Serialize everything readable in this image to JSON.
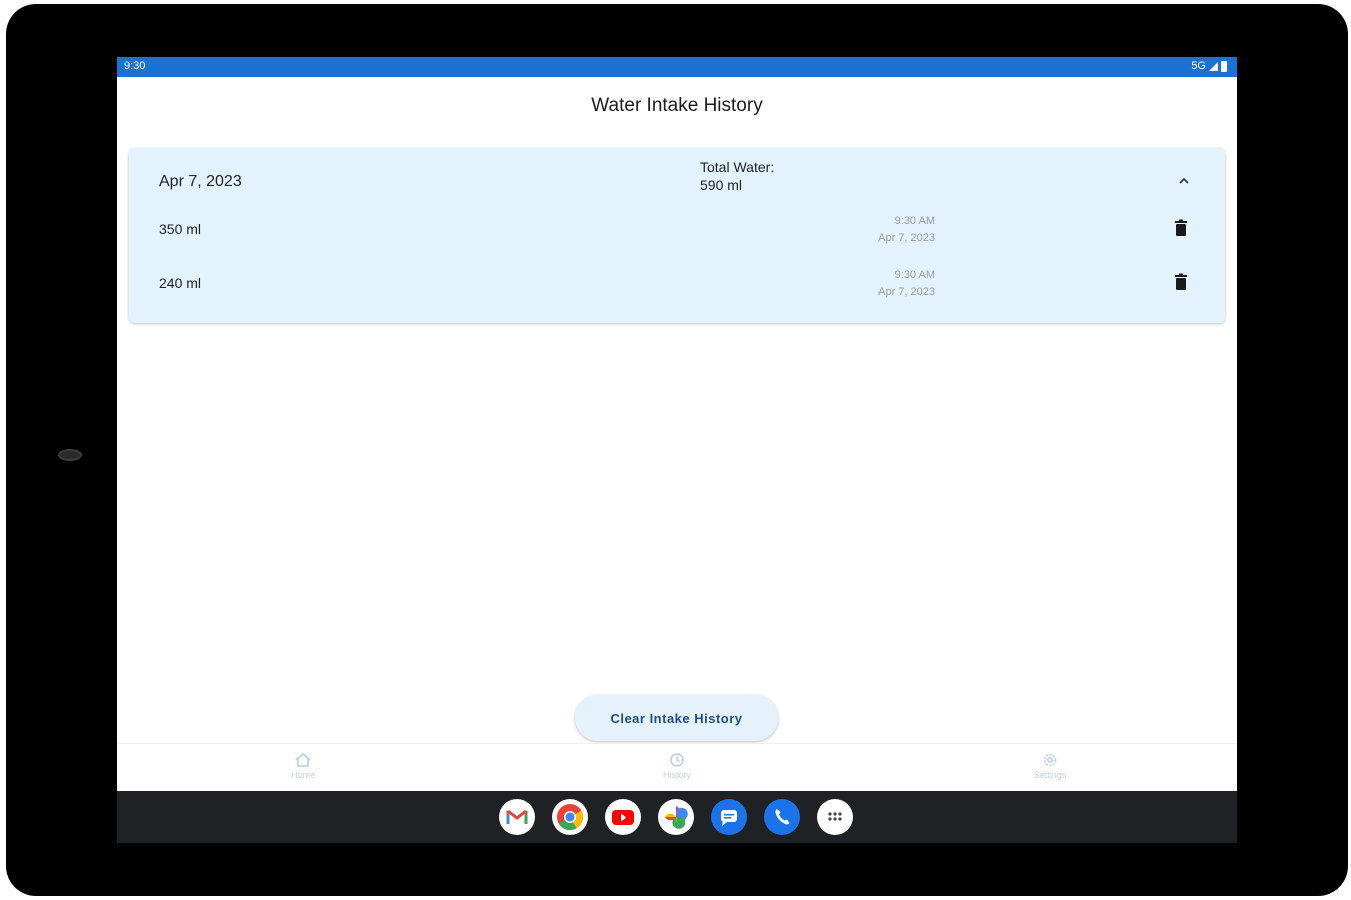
{
  "status_bar": {
    "time": "9:30",
    "network": "5G",
    "color": "#1a73d4"
  },
  "app": {
    "title": "Water Intake History"
  },
  "history_group": {
    "date": "Apr 7, 2023",
    "total_label": "Total Water:",
    "total_value": "590 ml",
    "expanded_icon": "chevron-up-icon",
    "entries": [
      {
        "amount": "350 ml",
        "time": "9:30 AM",
        "date": "Apr 7, 2023"
      },
      {
        "amount": "240 ml",
        "time": "9:30 AM",
        "date": "Apr 7, 2023"
      }
    ],
    "card_color": "#e3f3fd"
  },
  "actions": {
    "clear_label": "Clear Intake History"
  },
  "bottom_nav": {
    "items": [
      {
        "label": "Home",
        "icon": "home-icon"
      },
      {
        "label": "History",
        "icon": "history-icon"
      },
      {
        "label": "Settings",
        "icon": "gear-icon"
      }
    ]
  },
  "dock": {
    "apps": [
      "gmail-icon",
      "chrome-icon",
      "youtube-icon",
      "photos-icon",
      "messages-icon",
      "phone-icon",
      "app-drawer-icon"
    ]
  }
}
